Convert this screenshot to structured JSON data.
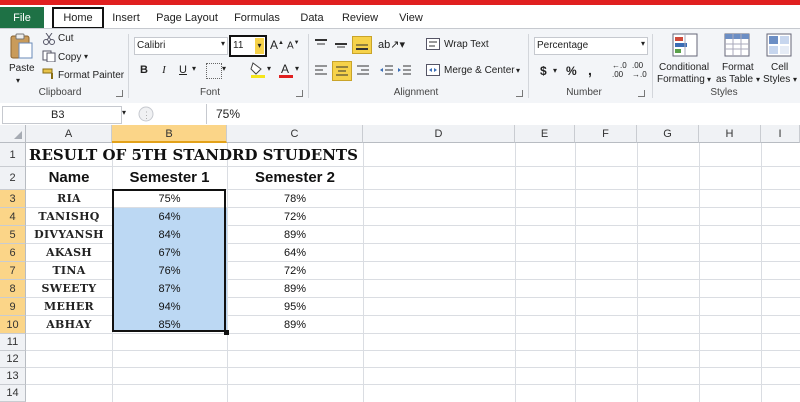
{
  "tabs": [
    "File",
    "Home",
    "Insert",
    "Page Layout",
    "Formulas",
    "Data",
    "Review",
    "View"
  ],
  "ribbon": {
    "clipboard": {
      "paste": "Paste",
      "cut": "Cut",
      "copy": "Copy",
      "format_painter": "Format Painter",
      "group_label": "Clipboard"
    },
    "font": {
      "name": "Calibri",
      "size": "11",
      "bold": "B",
      "italic": "I",
      "underline": "U",
      "group_label": "Font"
    },
    "alignment": {
      "wrap_text": "Wrap Text",
      "merge_center": "Merge & Center",
      "group_label": "Alignment"
    },
    "number": {
      "format": "Percentage",
      "currency": "$",
      "percent": "%",
      "comma": ",",
      "group_label": "Number"
    },
    "styles": {
      "conditional_1": "Conditional",
      "conditional_2": "Formatting",
      "format_1": "Format",
      "format_2": "as Table",
      "cell_1": "Cell",
      "cell_2": "Styles",
      "group_label": "Styles"
    }
  },
  "formula_bar": {
    "name_box": "B3",
    "value": "75%"
  },
  "columns": [
    "A",
    "B",
    "C",
    "D",
    "E",
    "F",
    "G",
    "H",
    "I"
  ],
  "rows": [
    "1",
    "2",
    "3",
    "4",
    "5",
    "6",
    "7",
    "8",
    "9",
    "10",
    "11",
    "12",
    "13",
    "14"
  ],
  "sheet": {
    "title": "RESULT OF 5TH STANDRD STUDENTS",
    "headers": [
      "Name",
      "Semester 1",
      "Semester 2"
    ],
    "students": [
      {
        "name": "RIA",
        "sem1": "75%",
        "sem2": "78%"
      },
      {
        "name": "TANISHQ",
        "sem1": "64%",
        "sem2": "72%"
      },
      {
        "name": "DIVYANSH",
        "sem1": "84%",
        "sem2": "89%"
      },
      {
        "name": "AKASH",
        "sem1": "67%",
        "sem2": "64%"
      },
      {
        "name": "TINA",
        "sem1": "76%",
        "sem2": "72%"
      },
      {
        "name": "SWEETY",
        "sem1": "87%",
        "sem2": "89%"
      },
      {
        "name": "MEHER",
        "sem1": "94%",
        "sem2": "95%"
      },
      {
        "name": "ABHAY",
        "sem1": "85%",
        "sem2": "89%"
      }
    ]
  },
  "colors": {
    "file_tab": "#1e7145",
    "selection": "#bcd8f3",
    "header_highlight": "#fbd588",
    "accent_red": "#e02020"
  }
}
